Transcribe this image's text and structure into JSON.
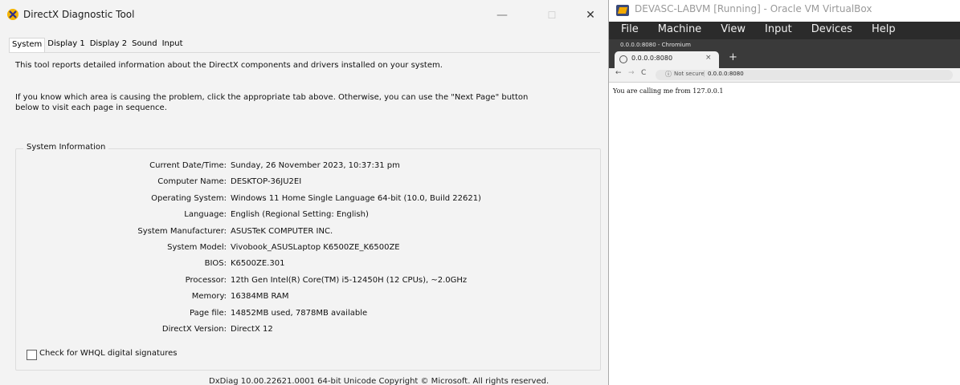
{
  "dxdiag": {
    "window_title": "DirectX Diagnostic Tool",
    "window_controls": {
      "minimize": "—",
      "maximize": "☐",
      "close": "✕"
    },
    "tabs": [
      {
        "label": "System",
        "active": true
      },
      {
        "label": "Display 1"
      },
      {
        "label": "Display 2"
      },
      {
        "label": "Sound"
      },
      {
        "label": "Input"
      }
    ],
    "intro_line1": "This tool reports detailed information about the DirectX components and drivers installed on your system.",
    "intro_line2": "If you know which area is causing the problem, click the appropriate tab above. Otherwise, you can use the \"Next Page\" button below to visit each page in sequence.",
    "group_title": "System Information",
    "rows": [
      {
        "label": "Current Date/Time:",
        "value": "Sunday, 26 November 2023, 10:37:31 pm"
      },
      {
        "label": "Computer Name:",
        "value": "DESKTOP-36JU2EI"
      },
      {
        "label": "Operating System:",
        "value": "Windows 11 Home Single Language 64-bit (10.0, Build 22621)"
      },
      {
        "label": "Language:",
        "value": "English (Regional Setting: English)"
      },
      {
        "label": "System Manufacturer:",
        "value": "ASUSTeK COMPUTER INC."
      },
      {
        "label": "System Model:",
        "value": "Vivobook_ASUSLaptop K6500ZE_K6500ZE"
      },
      {
        "label": "BIOS:",
        "value": "K6500ZE.301"
      },
      {
        "label": "Processor:",
        "value": "12th Gen Intel(R) Core(TM) i5-12450H (12 CPUs), ~2.0GHz"
      },
      {
        "label": "Memory:",
        "value": "16384MB RAM"
      },
      {
        "label": "Page file:",
        "value": "14852MB used, 7878MB available"
      },
      {
        "label": "DirectX Version:",
        "value": "DirectX 12"
      }
    ],
    "whql_label": "Check for WHQL digital signatures",
    "whql_checked": false,
    "footer": "DxDiag 10.00.22621.0001 64-bit Unicode  Copyright © Microsoft. All rights reserved."
  },
  "vbox": {
    "window_title": "DEVASC-LABVM [Running] - Oracle VM VirtualBox",
    "menu": [
      "File",
      "Machine",
      "View",
      "Input",
      "Devices",
      "Help"
    ],
    "browser": {
      "window_title": "0.0.0.0:8080 - Chromium",
      "tab_title": "0.0.0.0:8080",
      "tab_close": "×",
      "new_tab": "+",
      "nav_back": "←",
      "nav_forward": "→",
      "nav_reload": "C",
      "info_glyph": "ⓘ",
      "security_label": "Not secure",
      "separator": "|",
      "url": "0.0.0.0:8080",
      "page_text": "You are calling me from 127.0.0.1"
    }
  }
}
